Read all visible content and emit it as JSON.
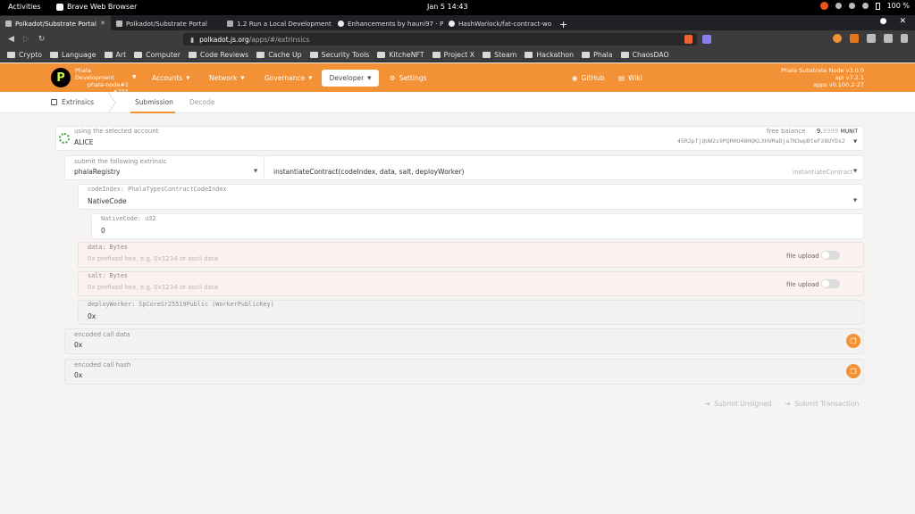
{
  "gnome": {
    "activities": "Activities",
    "app_name": "Brave Web Browser",
    "clock": "Jan 5  14:43",
    "battery": "100 %"
  },
  "tabs": [
    {
      "label": "Polkadot/Substrate Portal"
    },
    {
      "label": "Polkadot/Substrate Portal"
    },
    {
      "label": "1.2 Run a Local Development N"
    },
    {
      "label": "Enhancements by hauni97 · P"
    },
    {
      "label": "HashWarlock/fat-contract-wo"
    }
  ],
  "address": {
    "host": "polkadot.js.org",
    "path": "/apps/#/extrinsics"
  },
  "bookmarks": [
    "Crypto",
    "Language",
    "Art",
    "Computer",
    "Code Reviews",
    "Cache Up",
    "Security Tools",
    "KitcheNFT",
    "Project X",
    "Steam",
    "Hackathon",
    "Phala",
    "ChaosDAO"
  ],
  "header": {
    "chain_name": "Phala Development",
    "chain_sub": "phala-node#1",
    "block": "#721",
    "menus": {
      "accounts": "Accounts",
      "network": "Network",
      "governance": "Governance",
      "developer": "Developer",
      "settings": "Settings",
      "github": "GitHub",
      "wiki": "Wiki"
    },
    "node_name": "Phala Substrate Node v3.0.0",
    "api_version": "api v7.2.1",
    "apps_version": "apps v0.100.2-27"
  },
  "subnav": {
    "section": "Extrinsics",
    "tabs": [
      "Submission",
      "Decode"
    ]
  },
  "account": {
    "label": "using the selected account",
    "name": "ALICE",
    "balance_label": "free balance",
    "balance_int": "9.",
    "balance_dec": "9999",
    "balance_unit": "MUNIT",
    "address": "45R2pfjQUW2s9PQRHU48HQKLXHVMaDja7N3wpBteF28UYDs2"
  },
  "extrinsic": {
    "label": "submit the following extrinsic",
    "pallet": "phalaRegistry",
    "call": "instantiateContract(codeIndex, data, salt, deployWorker)",
    "call_short": "instantiateContract"
  },
  "params": {
    "code_index": {
      "label": "codeIndex: PhalaTypesContractCodeIndex",
      "value": "NativeCode"
    },
    "native_code": {
      "label": "NativeCode: u32",
      "value": "0"
    },
    "data": {
      "label": "data: Bytes",
      "placeholder": "0x prefixed hex, e.g. 0x1234 or ascii data",
      "upload": "file upload"
    },
    "salt": {
      "label": "salt: Bytes",
      "placeholder": "0x prefixed hex, e.g. 0x1234 or ascii data",
      "upload": "file upload"
    },
    "deploy_worker": {
      "label": "deployWorker: SpCoreSr25519Public (WorkerPublicKey)",
      "value": "0x"
    }
  },
  "encoded": {
    "data_label": "encoded call data",
    "data_value": "0x",
    "hash_label": "encoded call hash",
    "hash_value": "0x"
  },
  "actions": {
    "unsigned": "Submit Unsigned",
    "signed": "Submit Transaction"
  },
  "colors": {
    "accent": "#f29135"
  }
}
